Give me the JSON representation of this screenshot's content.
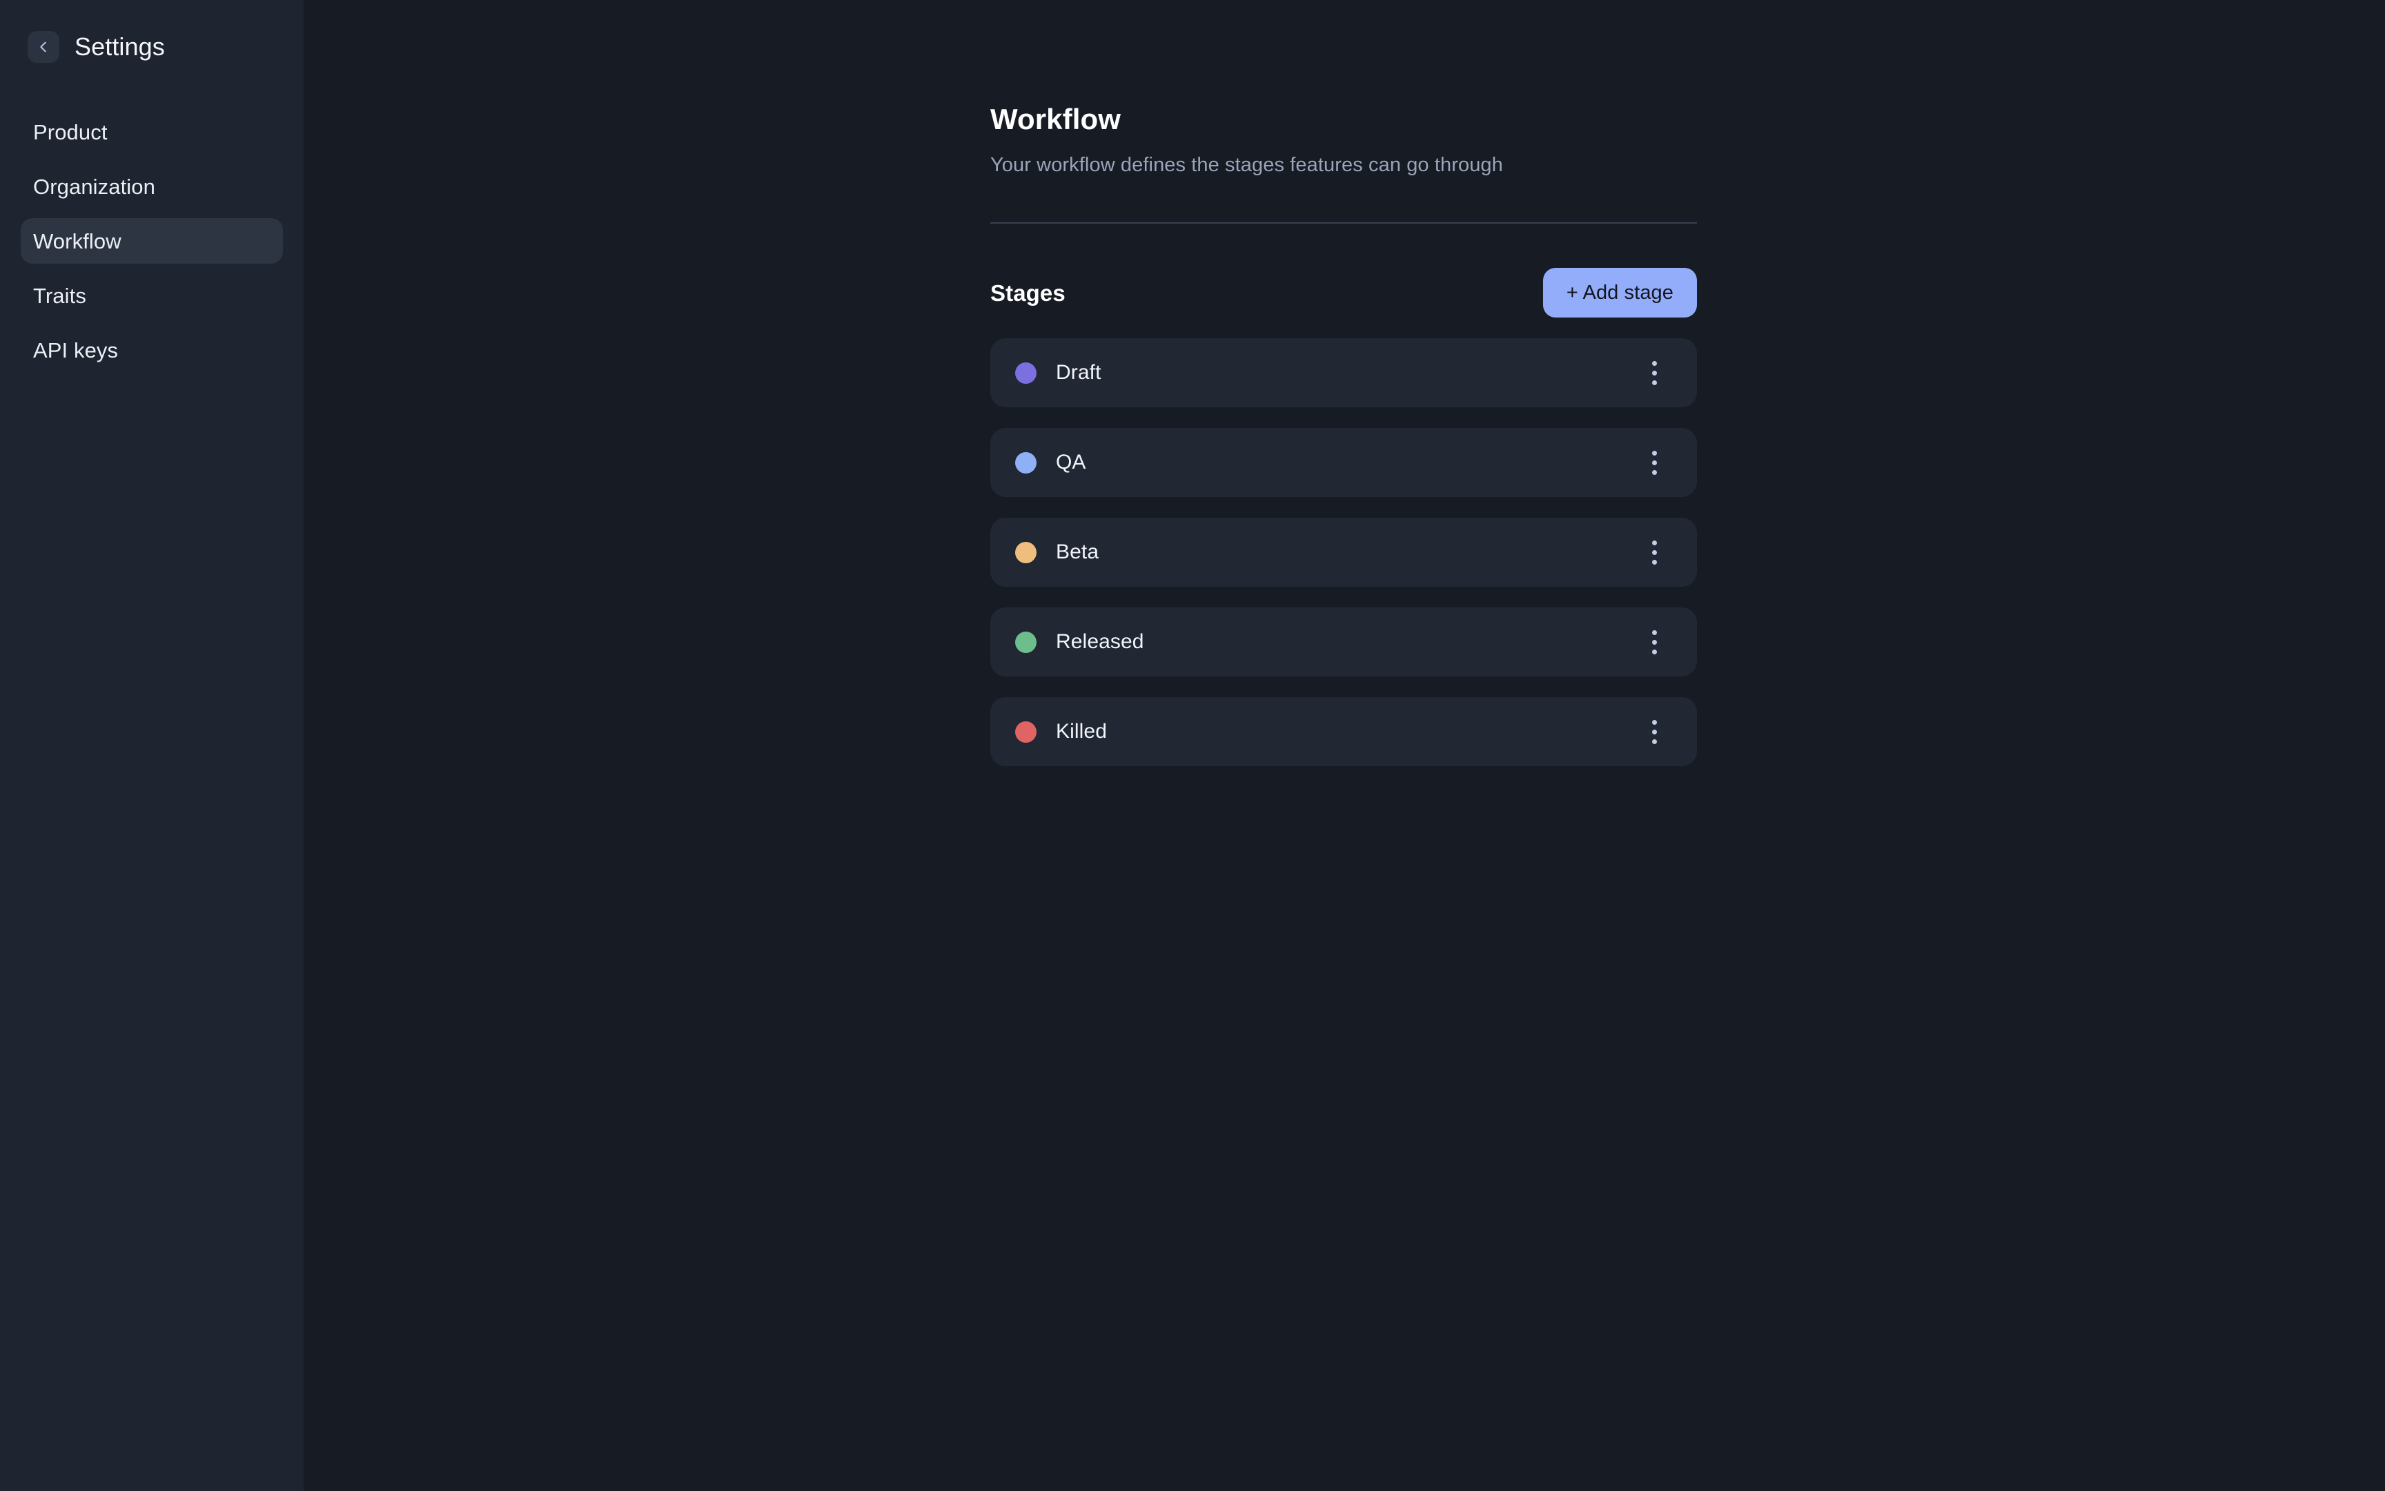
{
  "sidebar": {
    "title": "Settings",
    "back_icon": "chevron-left-icon",
    "items": [
      {
        "label": "Product",
        "active": false
      },
      {
        "label": "Organization",
        "active": false
      },
      {
        "label": "Workflow",
        "active": true
      },
      {
        "label": "Traits",
        "active": false
      },
      {
        "label": "API keys",
        "active": false
      }
    ]
  },
  "main": {
    "title": "Workflow",
    "subtitle": "Your workflow defines the stages features can go through",
    "stages_section": {
      "heading": "Stages",
      "add_button_label": "+ Add stage",
      "add_button_color": "#93adfb",
      "menu_icon": "more-vertical-icon",
      "stages": [
        {
          "name": "Draft",
          "color": "#7c6fe0"
        },
        {
          "name": "QA",
          "color": "#8fb0f7"
        },
        {
          "name": "Beta",
          "color": "#efbd7e"
        },
        {
          "name": "Released",
          "color": "#6dbe8c"
        },
        {
          "name": "Killed",
          "color": "#e06464"
        }
      ]
    }
  },
  "theme": {
    "sidebar_bg": "#1e2430",
    "main_bg": "#171b24",
    "row_bg": "#212733",
    "active_pill_bg": "#2d3442",
    "divider": "#39404f",
    "text_primary": "#f2f5fa",
    "text_muted": "#9aa5b9"
  }
}
